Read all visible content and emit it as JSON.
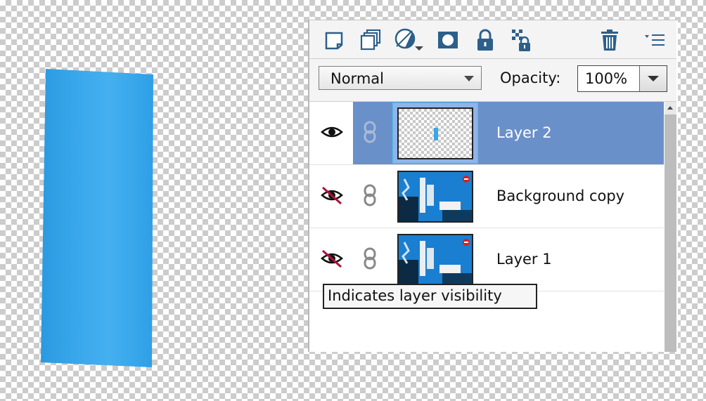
{
  "toolbar": {
    "icons": [
      "new-layer-icon",
      "duplicate-layer-icon",
      "adjustment-layer-icon",
      "layer-mask-icon",
      "lock-all-icon",
      "lock-transparency-icon",
      "delete-layer-icon",
      "panel-menu-icon"
    ]
  },
  "blend_mode": {
    "value": "Normal"
  },
  "opacity": {
    "label": "Opacity:",
    "value": "100%"
  },
  "layers": [
    {
      "name": "Layer 2",
      "visible": true,
      "selected": true
    },
    {
      "name": "Background copy",
      "visible": false,
      "selected": false
    },
    {
      "name": "Layer 1",
      "visible": false,
      "selected": false
    }
  ],
  "tooltip": {
    "text": "Indicates layer visibility"
  },
  "colors": {
    "selection": "#6a90c9",
    "canvas_shape": "#3aa6ea",
    "hidden_slash": "#b0103a",
    "icon_blue": "#2c5f8a"
  }
}
